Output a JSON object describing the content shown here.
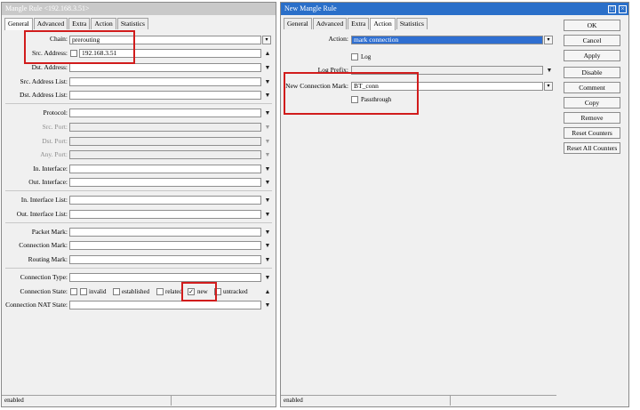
{
  "left": {
    "title": "Mangle Rule <192.168.3.51>",
    "tabs": [
      "General",
      "Advanced",
      "Extra",
      "Action",
      "Statistics"
    ],
    "fields": {
      "chain_label": "Chain:",
      "chain_value": "prerouting",
      "src_address_label": "Src. Address:",
      "src_address_value": "192.168.3.51",
      "dst_address_label": "Dst. Address:",
      "src_address_list_label": "Src. Address List:",
      "dst_address_list_label": "Dst. Address List:",
      "protocol_label": "Protocol:",
      "src_port_label": "Src. Port:",
      "dst_port_label": "Dst. Port:",
      "any_port_label": "Any. Port:",
      "in_interface_label": "In. Interface:",
      "out_interface_label": "Out. Interface:",
      "in_interface_list_label": "In. Interface List:",
      "out_interface_list_label": "Out. Interface List:",
      "packet_mark_label": "Packet Mark:",
      "connection_mark_label": "Connection Mark:",
      "routing_mark_label": "Routing Mark:",
      "connection_type_label": "Connection Type:",
      "connection_state_label": "Connection State:",
      "connection_nat_state_label": "Connection NAT State:"
    },
    "states": {
      "invalid": "invalid",
      "established": "established",
      "related": "related",
      "new": "new",
      "untracked": "untracked"
    },
    "status": "enabled"
  },
  "right": {
    "title": "New Mangle Rule",
    "tabs": [
      "General",
      "Advanced",
      "Extra",
      "Action",
      "Statistics"
    ],
    "fields": {
      "action_label": "Action:",
      "action_value": "mark connection",
      "log_label": "Log",
      "log_prefix_label": "Log Prefix:",
      "new_connection_mark_label": "New Connection Mark:",
      "new_connection_mark_value": "BT_conn",
      "passthrough_label": "Passthrough"
    },
    "buttons": [
      "OK",
      "Cancel",
      "Apply",
      "Disable",
      "Comment",
      "Copy",
      "Remove",
      "Reset Counters",
      "Reset All Counters"
    ],
    "status": "enabled"
  },
  "colors": {
    "highlight": "#d11c1c",
    "selection": "#2f6fd1",
    "title_active": "#2a6fc9"
  }
}
